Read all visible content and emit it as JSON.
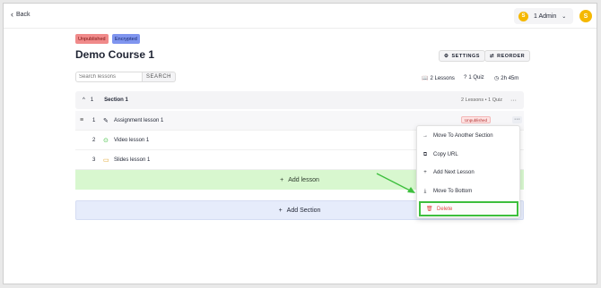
{
  "topbar": {
    "back_label": "Back",
    "admin_count": "1 Admin",
    "coin_letter": "S",
    "avatar_letter": "S"
  },
  "badges": {
    "unpublished": "Unpublished",
    "encrypted": "Encrypted"
  },
  "course": {
    "title": "Demo Course 1"
  },
  "toolbar": {
    "settings_label": "SETTINGS",
    "reorder_label": "REORDER"
  },
  "search": {
    "placeholder": "Search lessons",
    "button_label": "SEARCH"
  },
  "stats": {
    "lessons": "2 Lessons",
    "quizzes": "1 Quiz",
    "duration": "2h 45m"
  },
  "section": {
    "number": "1",
    "title": "Section 1",
    "meta": "2 Lessons • 1 Quiz"
  },
  "lessons": [
    {
      "number": "1",
      "title": "Assignment lesson 1",
      "icon": "pencil-icon",
      "status": "Unpublished"
    },
    {
      "number": "2",
      "title": "Video lesson 1",
      "icon": "play-icon"
    },
    {
      "number": "3",
      "title": "Slides lesson 1",
      "icon": "slides-icon"
    }
  ],
  "actions": {
    "add_lesson": "Add lesson",
    "add_section": "Add Section"
  },
  "menu": {
    "items": [
      "Move To Another Section",
      "Copy URL",
      "Add Next Lesson",
      "Move To Bottom",
      "Delete"
    ]
  },
  "colors": {
    "highlight": "#3dbf3d",
    "delete": "#e04646",
    "add_lesson_bg": "#d8f7cf",
    "add_section_bg": "#e6ecfb",
    "accent": "#f5b800"
  }
}
